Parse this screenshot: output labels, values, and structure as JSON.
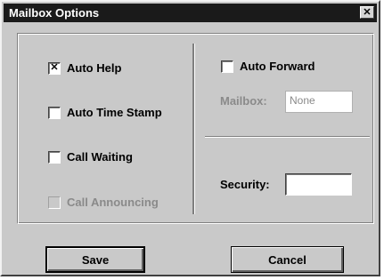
{
  "window": {
    "title": "Mailbox Options",
    "close_glyph": "✕"
  },
  "left": {
    "auto_help": {
      "label": "Auto Help",
      "checked": true,
      "mark": "✕"
    },
    "auto_time_stamp": {
      "label": "Auto Time Stamp",
      "checked": false
    },
    "call_waiting": {
      "label": "Call Waiting",
      "checked": false
    },
    "call_announcing": {
      "label": "Call Announcing",
      "checked": false,
      "disabled": true
    }
  },
  "right": {
    "auto_forward": {
      "label": "Auto Forward",
      "checked": false
    },
    "mailbox": {
      "label": "Mailbox:",
      "value": "None",
      "disabled": true
    },
    "security": {
      "label": "Security:",
      "value": ""
    }
  },
  "buttons": {
    "save": "Save",
    "cancel": "Cancel"
  },
  "icons": {
    "close": "close-icon"
  },
  "colors": {
    "titlebar": "#1a1a1a",
    "face": "#c9c9c9",
    "disabled_text": "#8a8a8a"
  }
}
